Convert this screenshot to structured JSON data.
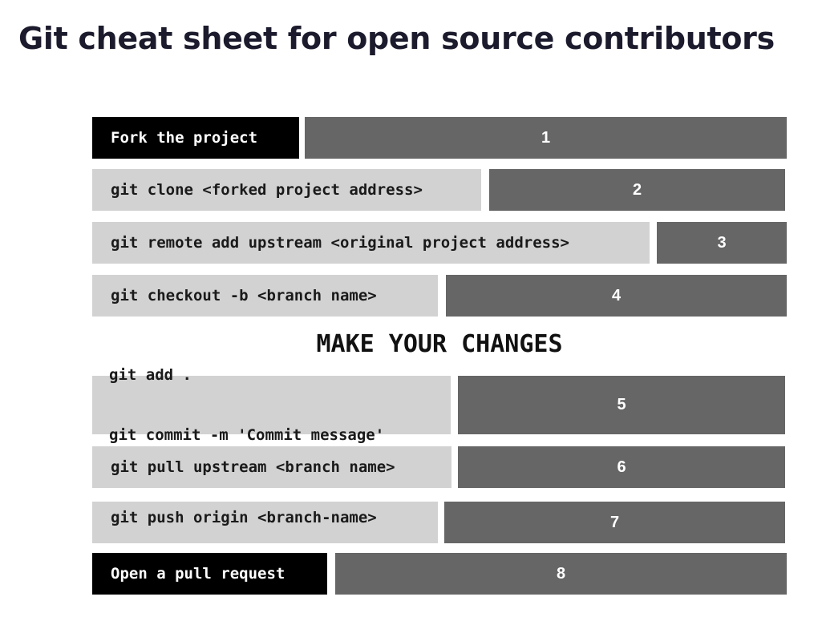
{
  "title": "Git cheat sheet for open source contributors",
  "steps": [
    {
      "command": "Fork the project",
      "number": "1",
      "style": "dark"
    },
    {
      "command": "git clone <forked project address>",
      "number": "2",
      "style": "light"
    },
    {
      "command": "git remote add upstream <original project address>",
      "number": "3",
      "style": "light"
    },
    {
      "command": "git checkout -b <branch name>",
      "number": "4",
      "style": "light"
    },
    {
      "command_lines": [
        "git add .",
        "git commit -m 'Commit message'"
      ],
      "number": "5",
      "style": "light"
    },
    {
      "command": "git pull upstream <branch name>",
      "number": "6",
      "style": "light"
    },
    {
      "command": "git push origin <branch-name>",
      "number": "7",
      "style": "light"
    },
    {
      "command": "Open a pull request",
      "number": "8",
      "style": "dark"
    }
  ],
  "section_heading": "MAKE YOUR CHANGES",
  "colors": {
    "command_light_bg": "#d2d2d2",
    "command_dark_bg": "#000000",
    "number_bg": "#666666",
    "title_text": "#1b1b2d"
  }
}
